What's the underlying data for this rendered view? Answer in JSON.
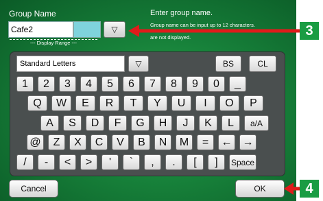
{
  "header": {
    "title": "Group Name",
    "name_value": "Cafe2",
    "display_range_label": "--- Display Range ---",
    "help_line1": "Enter group name.",
    "help_line2": "Group name can be input up to 12 characters.",
    "help_line3": "are not displayed."
  },
  "dropdown_glyph": "▽",
  "keyboard": {
    "charset_value": "Standard Letters",
    "bs": "BS",
    "cl": "CL",
    "row1": [
      "1",
      "2",
      "3",
      "4",
      "5",
      "6",
      "7",
      "8",
      "9",
      "0",
      "_"
    ],
    "row2": [
      "Q",
      "W",
      "E",
      "R",
      "T",
      "Y",
      "U",
      "I",
      "O",
      "P"
    ],
    "row3": [
      "A",
      "S",
      "D",
      "F",
      "G",
      "H",
      "J",
      "K",
      "L",
      "a/A"
    ],
    "row4": [
      "@",
      "Z",
      "X",
      "C",
      "V",
      "B",
      "N",
      "M",
      "=",
      "←",
      "→"
    ],
    "row5": [
      "/",
      "-",
      "<",
      ">",
      "'",
      "`",
      ",",
      ".",
      "[",
      "]",
      "Space"
    ]
  },
  "footer": {
    "cancel": "Cancel",
    "ok": "OK"
  },
  "callouts": {
    "c3": "3",
    "c4": "4"
  },
  "colors": {
    "callout_green": "#1a9c43",
    "arrow_red": "#e01b1b"
  }
}
